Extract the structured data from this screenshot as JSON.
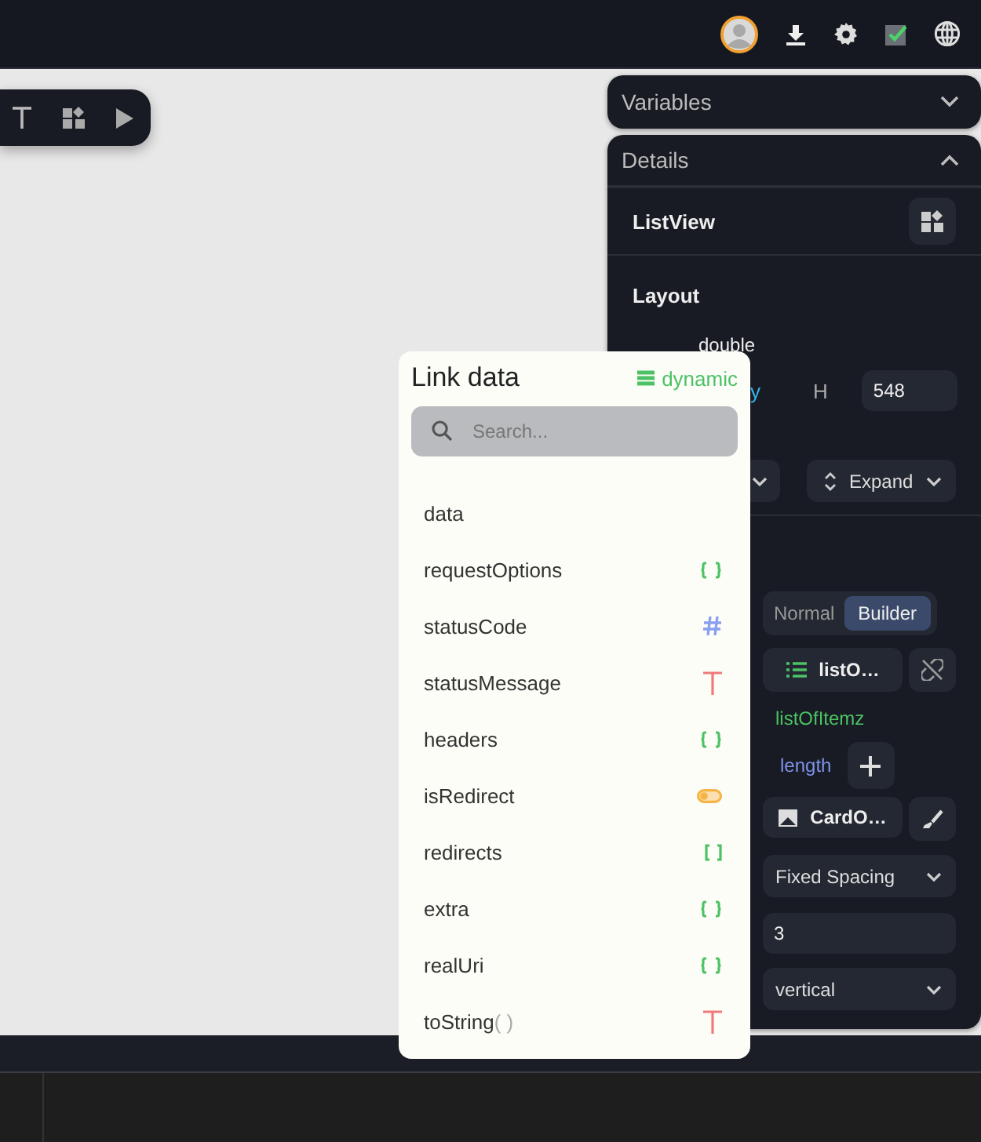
{
  "variables_panel": {
    "title": "Variables",
    "expanded": false
  },
  "details_panel": {
    "title": "Details",
    "expanded": true,
    "widget": "ListView",
    "section": "Layout",
    "width_value": "double",
    "width_fragment": "y",
    "height_label": "H",
    "height_value": "548",
    "main_axis": "Expand",
    "mode_tabs": [
      {
        "label": "Normal",
        "selected": false
      },
      {
        "label": "Builder",
        "selected": true
      }
    ],
    "source_button": "listO…",
    "source_path": "listOfItemz",
    "count_field": "length",
    "item_button": "CardO…",
    "spacing": "Fixed Spacing",
    "spacing_value": "3",
    "direction": "vertical"
  },
  "link_data": {
    "title": "Link data",
    "mode": "dynamic",
    "search": {
      "placeholder": "Search..."
    },
    "items": [
      {
        "name": "data",
        "kind": "none"
      },
      {
        "name": "requestOptions",
        "kind": "map"
      },
      {
        "name": "statusCode",
        "kind": "number"
      },
      {
        "name": "statusMessage",
        "kind": "string"
      },
      {
        "name": "headers",
        "kind": "map"
      },
      {
        "name": "isRedirect",
        "kind": "bool"
      },
      {
        "name": "redirects",
        "kind": "list"
      },
      {
        "name": "extra",
        "kind": "map"
      },
      {
        "name": "realUri",
        "kind": "map"
      },
      {
        "name": "toString",
        "args": "( )",
        "kind": "string"
      }
    ]
  }
}
